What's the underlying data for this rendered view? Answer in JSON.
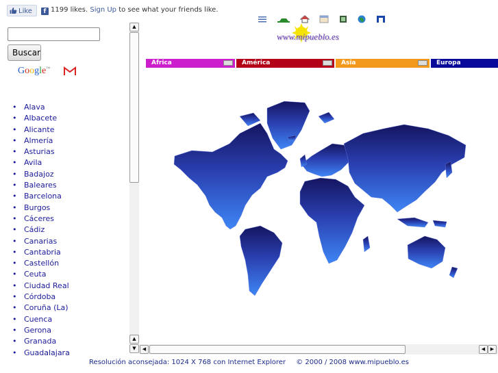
{
  "facebook": {
    "like_label": "Like",
    "likes_text": "1199 likes.",
    "signup_link": "Sign Up",
    "suffix_text": "to see what your friends like."
  },
  "search": {
    "input_value": "",
    "button_label": "Buscar"
  },
  "google_logo": [
    "G",
    "o",
    "o",
    "g",
    "l",
    "e"
  ],
  "google_tm": "™",
  "provinces": [
    "Alava",
    "Albacete",
    "Alicante",
    "Almería",
    "Asturias",
    "Avila",
    "Badajoz",
    "Baleares",
    "Barcelona",
    "Burgos",
    "Cáceres",
    "Cádiz",
    "Canarias",
    "Cantabria",
    "Castellón",
    "Ceuta",
    "Ciudad Real",
    "Córdoba",
    "Coruña (La)",
    "Cuenca",
    "Gerona",
    "Granada",
    "Guadalajara"
  ],
  "header": {
    "site_logo": "www.mipueblo.es"
  },
  "continents": [
    {
      "label": "Africa",
      "color": "#cc1ecc"
    },
    {
      "label": "América",
      "color": "#b30018"
    },
    {
      "label": "Asia",
      "color": "#f39a1c"
    },
    {
      "label": "Europa",
      "color": "#0a0a9a"
    }
  ],
  "footer": {
    "resolution": "Resolución aconsejada: 1024 X 768 con Internet Explorer",
    "copyright": "© 2000 / 2008 www.mipueblo.es"
  },
  "colors": {
    "map_dark": "#1c1c6e",
    "map_light": "#3a78ee",
    "link": "#1a1a9a"
  }
}
